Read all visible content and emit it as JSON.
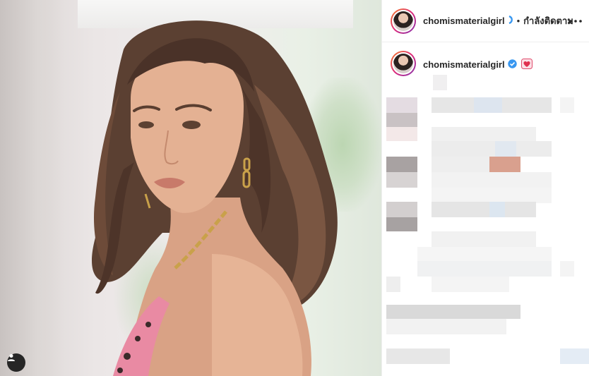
{
  "post": {
    "photo_alt": "portrait photo",
    "user_tag_icon": "user-tag-icon"
  },
  "header": {
    "username": "chomismaterialgirl",
    "follow_label": "กำลังติดตาม",
    "separator": "•",
    "more_icon": "more-options-icon"
  },
  "caption": {
    "username": "chomismaterialgirl",
    "verified_icon": "verified-badge-icon",
    "emoji_icon": "heart-emoji-icon"
  },
  "colors": {
    "text": "#262626",
    "verified_blue": "#3897f0",
    "divider": "#efefef",
    "story_ring": [
      "#f58529",
      "#dd2a7b",
      "#8134af"
    ]
  }
}
